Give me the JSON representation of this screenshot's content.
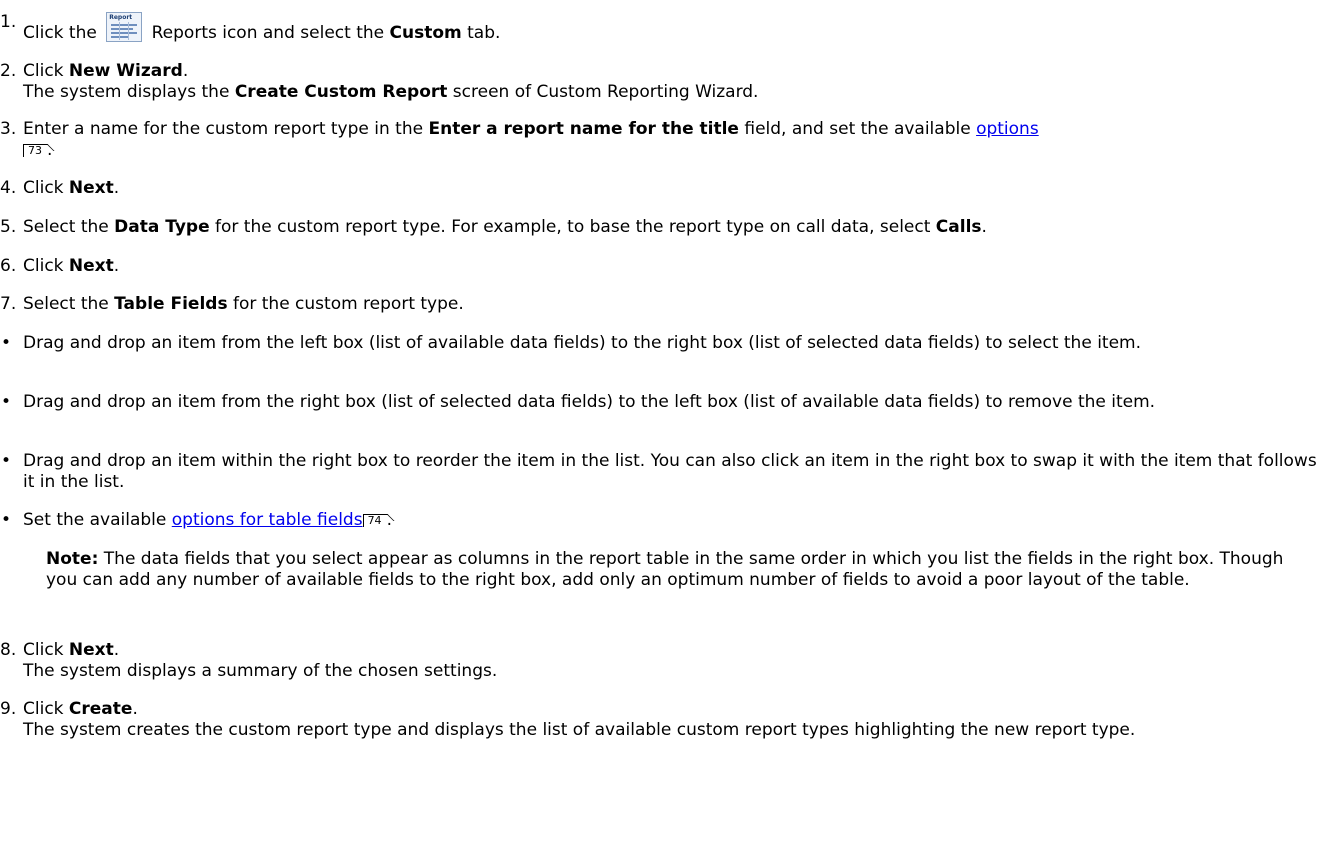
{
  "steps": [
    {
      "num": "1.",
      "pre": "Click the",
      "icon_label": "Report",
      "mid": "Reports icon and select the",
      "bold": "Custom",
      "post": "tab."
    },
    {
      "num": "2.",
      "pre": "Click",
      "bold": "New Wizard",
      "post": ".",
      "sub_pre": "The system displays the",
      "sub_bold": "Create Custom Report",
      "sub_post": "screen of Custom Reporting Wizard."
    },
    {
      "num": "3.",
      "pre": "Enter a name for the custom report type in the",
      "bold": "Enter a report name for the title",
      "mid": "field, and set the available",
      "link": "options",
      "xref": "73",
      "post": "."
    },
    {
      "num": "4.",
      "pre": "Click",
      "bold": "Next",
      "post": "."
    },
    {
      "num": "5.",
      "pre": "Select the",
      "bold": "Data Type",
      "mid": "for the custom report type. For example, to base the report type on call data, select",
      "bold2": "Calls",
      "post": "."
    },
    {
      "num": "6.",
      "pre": "Click",
      "bold": "Next",
      "post": "."
    },
    {
      "num": "7.",
      "pre": "Select the",
      "bold": "Table Fields",
      "post": "for the custom report type."
    },
    {
      "num": "8.",
      "pre": "Click",
      "bold": "Next",
      "post": ".",
      "sub": "The system displays a summary of the chosen settings."
    },
    {
      "num": "9.",
      "pre": "Click",
      "bold": "Create",
      "post": ".",
      "sub": "The system creates the custom report type and displays the list of available custom report types highlighting the new report type."
    }
  ],
  "bullets": [
    {
      "text": "Drag and drop an item from the left box (list of available data fields) to the right box (list of selected data fields) to select the item."
    },
    {
      "text": "Drag and drop an item from the right box (list of selected data fields) to the left box (list of available data fields) to remove the item."
    },
    {
      "text": "Drag and drop an item within the right box to reorder the item in the list. You can also click an item in the right box to swap it with the item that follows it in the list."
    },
    {
      "pre": "Set the available",
      "link": "options for table fields",
      "xref": "74",
      "post": "."
    }
  ],
  "note": {
    "label": "Note:",
    "text": "The data fields that you select appear as columns in the report table in the same order in which you list the fields in the right box. Though you can add any number of available fields to the right box, add only an optimum number of fields to avoid a poor layout of the table."
  }
}
